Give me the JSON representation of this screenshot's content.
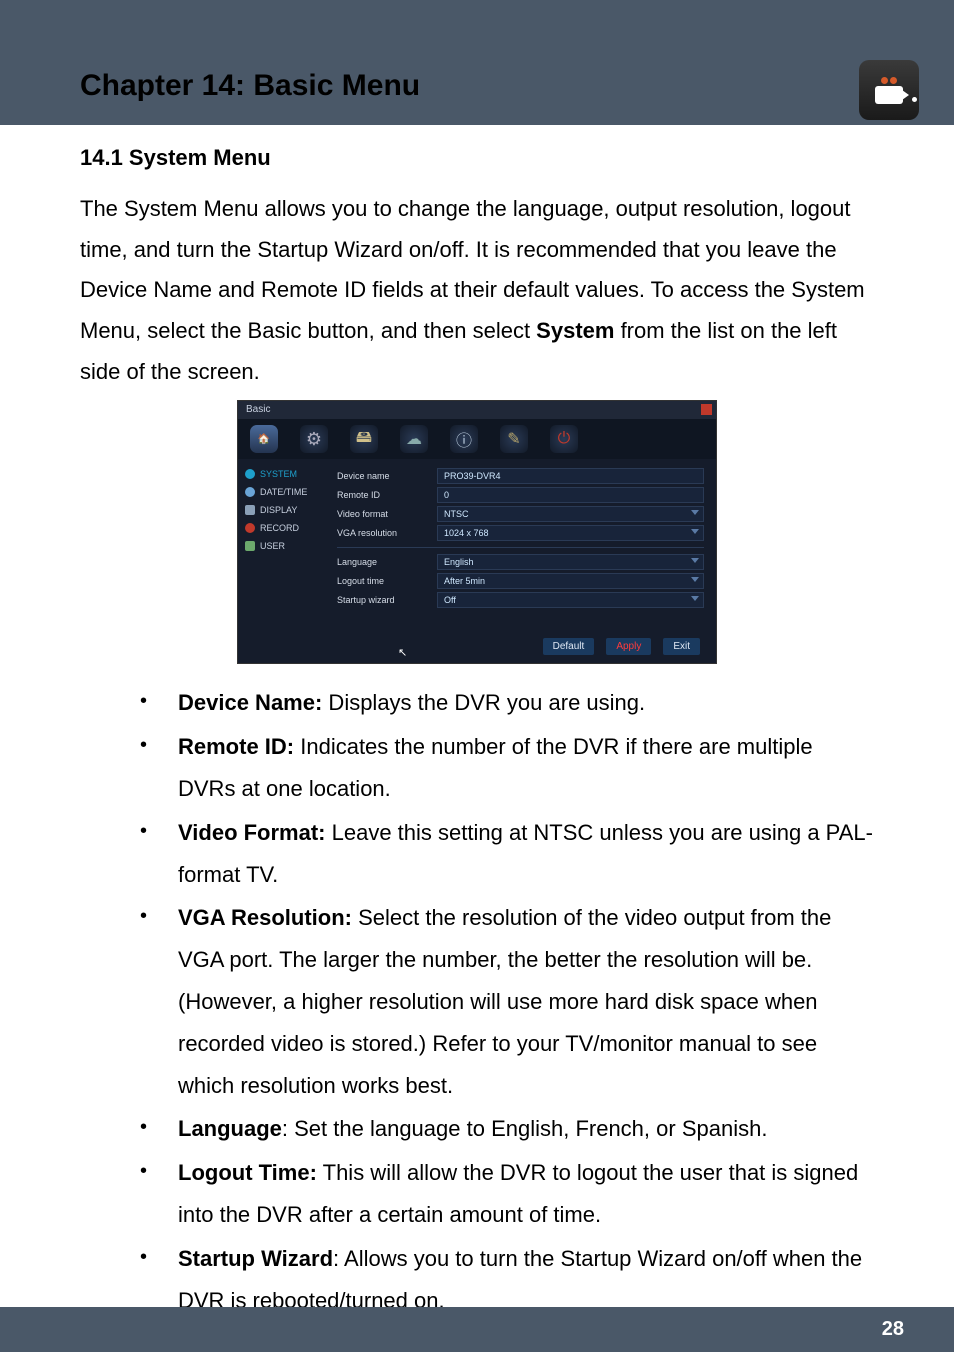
{
  "header": {
    "chapter_title": "Chapter 14: Basic Menu"
  },
  "section": {
    "number_title": "14.1 System Menu",
    "intro_part1": "The System Menu allows you to change the language, output resolution, logout time, and turn the Startup Wizard on/off. It is recommended that you leave the Device Name and Remote ID fields at their default values.  To access the System Menu, select the Basic button, and then select ",
    "intro_strong": "System",
    "intro_part2": " from the list on the left side of the screen."
  },
  "screenshot": {
    "title": "Basic",
    "sidebar": [
      {
        "label": "SYSTEM",
        "active": true,
        "icon": "g"
      },
      {
        "label": "DATE/TIME",
        "active": false,
        "icon": "clock"
      },
      {
        "label": "DISPLAY",
        "active": false,
        "icon": "mon"
      },
      {
        "label": "RECORD",
        "active": false,
        "icon": "rec"
      },
      {
        "label": "USER",
        "active": false,
        "icon": "usr"
      }
    ],
    "rows_top": [
      {
        "label": "Device name",
        "value": "PRO39-DVR4",
        "dropdown": false
      },
      {
        "label": "Remote ID",
        "value": "0",
        "dropdown": false
      },
      {
        "label": "Video format",
        "value": "NTSC",
        "dropdown": true
      },
      {
        "label": "VGA resolution",
        "value": "1024 x 768",
        "dropdown": true
      }
    ],
    "rows_bottom": [
      {
        "label": "Language",
        "value": "English",
        "dropdown": true
      },
      {
        "label": "Logout time",
        "value": "After 5min",
        "dropdown": true
      },
      {
        "label": "Startup wizard",
        "value": "Off",
        "dropdown": true
      }
    ],
    "buttons": {
      "default": "Default",
      "apply": "Apply",
      "exit": "Exit"
    }
  },
  "bullets": [
    {
      "term": "Device Name:",
      "desc": " Displays the DVR you are using."
    },
    {
      "term": "Remote ID:",
      "desc": " Indicates the number of the DVR if there are multiple DVRs at one location."
    },
    {
      "term": "Video Format:",
      "desc": " Leave this setting at NTSC unless you are using a PAL-format TV."
    },
    {
      "term": "VGA Resolution:",
      "desc": " Select the resolution of the video output from the VGA port. The larger the number, the better the resolution will be. (However, a higher resolution will use more hard disk space when recorded video is stored.) Refer to your TV/monitor manual to see which resolution works best."
    },
    {
      "term": "Language",
      "desc": ": Set the language to English, French, or Spanish."
    },
    {
      "term": "Logout Time:",
      "desc": " This will allow the DVR to logout the user that is signed into the DVR after a certain amount of time."
    },
    {
      "term": "Startup Wizard",
      "desc": ": Allows you to turn the Startup Wizard on/off when the DVR is rebooted/turned on."
    }
  ],
  "page_number": "28"
}
